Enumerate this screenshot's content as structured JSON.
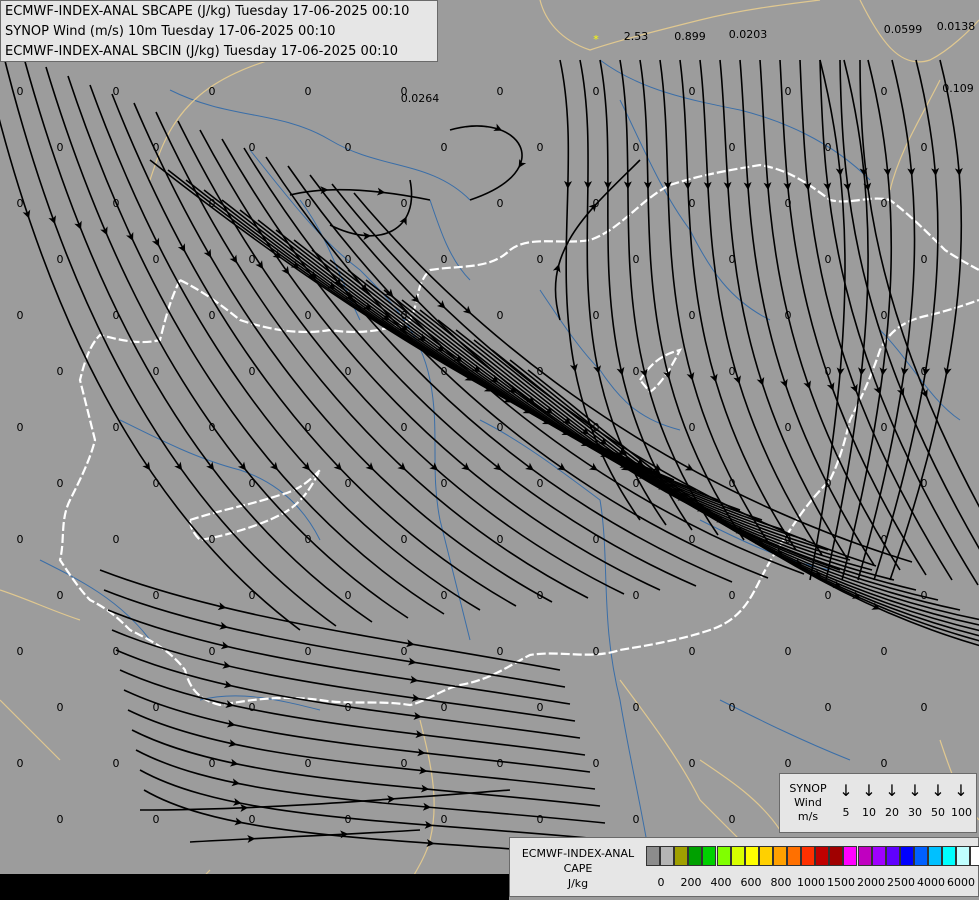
{
  "header": {
    "line1": "ECMWF-INDEX-ANAL SBCAPE (J/kg) Tuesday 17-06-2025 00:10",
    "line2": "SYNOP Wind (m/s) 10m Tuesday 17-06-2025 00:10",
    "line3": "ECMWF-INDEX-ANAL SBCIN (J/kg) Tuesday 17-06-2025 00:10"
  },
  "wind_legend": {
    "title_lines": [
      "SYNOP",
      "Wind",
      "m/s"
    ],
    "values": [
      "5",
      "10",
      "20",
      "30",
      "50",
      "100"
    ],
    "arrow_glyph": "↓"
  },
  "cape_legend": {
    "title_lines": [
      "ECMWF-INDEX-ANAL",
      "CAPE",
      "J/kg"
    ],
    "colors": [
      "#8c8c8c",
      "#b4b4b4",
      "#a0a000",
      "#00a000",
      "#00d000",
      "#80ff00",
      "#d8ff00",
      "#ffff00",
      "#ffd000",
      "#ffa000",
      "#ff7000",
      "#ff3000",
      "#c00000",
      "#a00000",
      "#ff00ff",
      "#c000c0",
      "#a000ff",
      "#6000ff",
      "#0000ff",
      "#0060ff",
      "#00c0ff",
      "#00ffff",
      "#c0ffff",
      "#ffffff"
    ],
    "ticks": [
      "0",
      "200",
      "400",
      "600",
      "800",
      "1000",
      "1500",
      "2000",
      "2500",
      "4000",
      "6000"
    ]
  },
  "map": {
    "background_color": "#9c9c9c",
    "border_color": "#ffffff",
    "river_color": "#3a6ea8",
    "outer_border_color": "#e0c890",
    "streamline_color": "#000000",
    "station_values": [
      "0",
      "0",
      "0",
      "0",
      "0",
      "0",
      "0",
      "0",
      "0",
      "0",
      "0",
      "0",
      "0",
      "0",
      "0",
      "0",
      "0",
      "0",
      "0",
      "0",
      "0",
      "0",
      "0",
      "0",
      "0",
      "0",
      "0",
      "0",
      "0",
      "0",
      "0",
      "0",
      "0",
      "0",
      "0",
      "0",
      "0",
      "0",
      "0",
      "0",
      "0",
      "0",
      "0",
      "0",
      "0",
      "0",
      "0",
      "0",
      "0",
      "0",
      "0",
      "0",
      "0",
      "0",
      "0",
      "0",
      "0",
      "0",
      "0",
      "0",
      "0",
      "0",
      "0",
      "0",
      "0",
      "0",
      "0",
      "0",
      "0",
      "0",
      "0",
      "0",
      "0",
      "0",
      "0",
      "0",
      "0",
      "0",
      "0",
      "0",
      "0",
      "0",
      "0",
      "0",
      "0",
      "0",
      "0",
      "0",
      "0",
      "0",
      "0",
      "0",
      "0",
      "0",
      "0",
      "0",
      "0",
      "0",
      "0",
      "0",
      "0",
      "0",
      "0",
      "0",
      "0",
      "0",
      "0",
      "0",
      "0",
      "0",
      "0",
      "0",
      "0",
      "0",
      "0",
      "0",
      "0",
      "0",
      "0",
      "0",
      "0",
      "0",
      "0",
      "0",
      "0",
      "0",
      "0",
      "0",
      "0",
      "0",
      "0",
      "0",
      "0",
      "0",
      "0",
      "0",
      "0",
      "0",
      "0",
      "0",
      "0.0264",
      "2.53",
      "0.899",
      "0.0203",
      "0.0599",
      "0.0138",
      "0.109"
    ]
  }
}
